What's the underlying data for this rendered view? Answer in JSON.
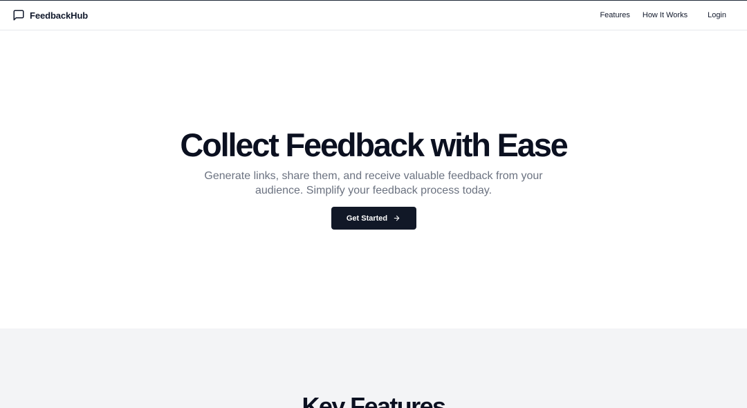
{
  "brand": {
    "name": "FeedbackHub",
    "icon": "message-square-icon"
  },
  "nav": {
    "features": "Features",
    "how_it_works": "How It Works",
    "login": "Login"
  },
  "hero": {
    "title": "Collect Feedback with Ease",
    "subtitle": "Generate links, share them, and receive valuable feedback from your audience. Simplify your feedback process today.",
    "cta_label": "Get Started",
    "cta_icon": "arrow-right-icon"
  },
  "features": {
    "title": "Key Features"
  },
  "colors": {
    "primary": "#111827",
    "text": "#0f172a",
    "muted": "#6b7280",
    "section_bg": "#f3f4f6"
  }
}
